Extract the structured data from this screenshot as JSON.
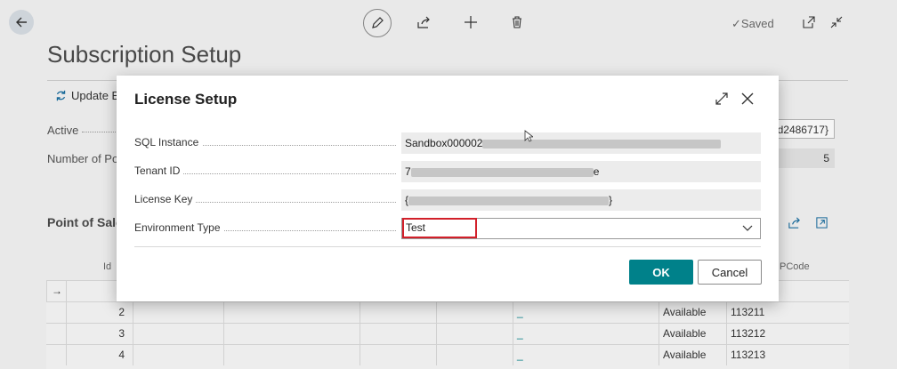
{
  "toolbar": {
    "saved_label": "Saved"
  },
  "page": {
    "title": "Subscription Setup",
    "update_button_label": "Update En",
    "active_label": "Active",
    "number_label": "Number of Poi",
    "guid_value": "d2486717}",
    "count_value": "5",
    "pos_section_title": "Point of Sale",
    "id_col_header": "Id",
    "pcode_col_header": "PCode",
    "rows": [
      {
        "id": "2",
        "dash": "_",
        "status": "Available",
        "code": "113211"
      },
      {
        "id": "3",
        "dash": "_",
        "status": "Available",
        "code": "113212"
      },
      {
        "id": "4",
        "dash": "_",
        "status": "Available",
        "code": "113213"
      }
    ]
  },
  "dialog": {
    "title": "License Setup",
    "fields": {
      "sql_instance_label": "SQL Instance",
      "sql_instance_value": "Sandbox000002",
      "tenant_id_label": "Tenant ID",
      "tenant_id_value_prefix": "7",
      "tenant_id_value_suffix": "e",
      "license_key_label": "License Key",
      "license_key_open": "{",
      "license_key_close": "}",
      "environment_type_label": "Environment Type",
      "environment_type_value": "Test"
    },
    "ok_label": "OK",
    "cancel_label": "Cancel"
  },
  "colors": {
    "accent": "#00818a",
    "highlight": "#d2202a"
  }
}
